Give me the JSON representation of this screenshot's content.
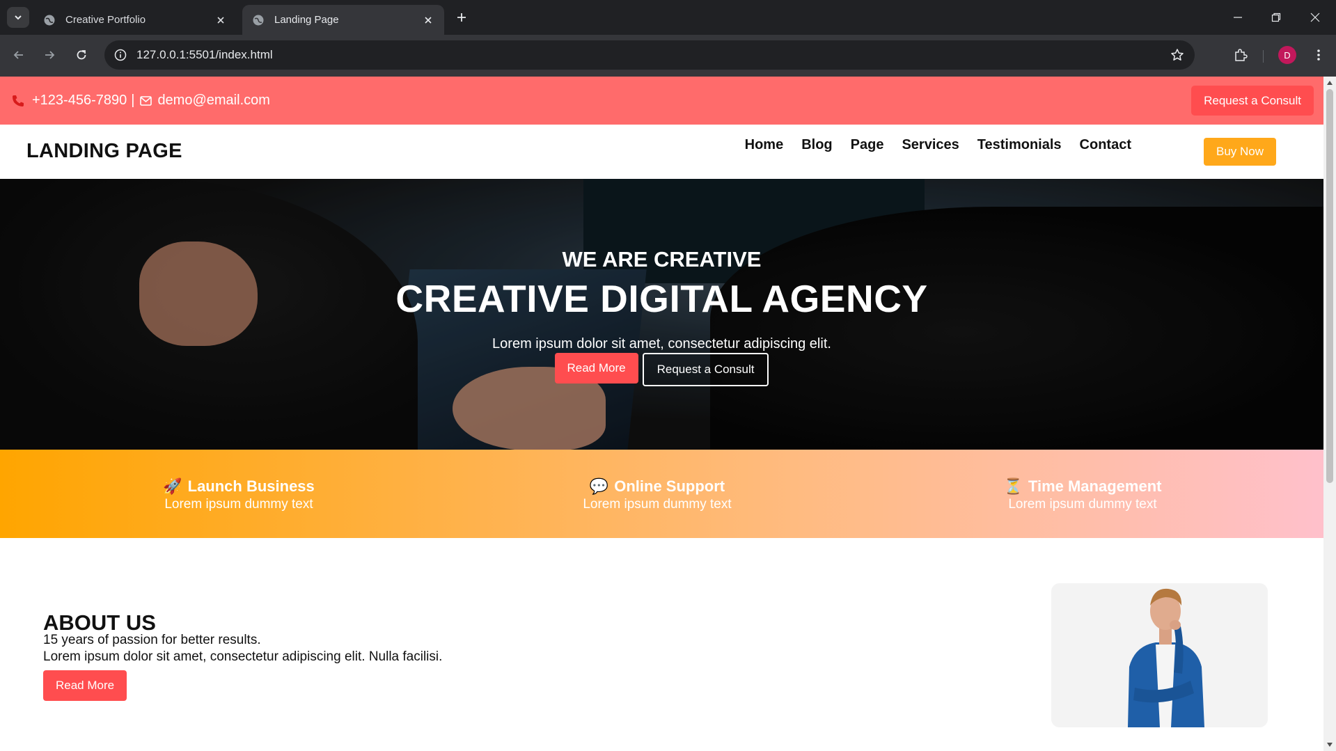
{
  "browser": {
    "tabs": [
      {
        "title": "Creative Portfolio"
      },
      {
        "title": "Landing Page"
      }
    ],
    "url": "127.0.0.1:5501/index.html",
    "profile_initial": "D"
  },
  "topbar": {
    "phone": "+123-456-7890",
    "separator": "|",
    "email": "demo@email.com",
    "consult_label": "Request a Consult",
    "bg_color": "#ff6b6b"
  },
  "navbar": {
    "logo": "LANDING PAGE",
    "menu": [
      "Home",
      "Blog",
      "Page",
      "Services",
      "Testimonials",
      "Contact"
    ],
    "buy_label": "Buy Now",
    "buy_color": "#ffa81a"
  },
  "hero": {
    "subtitle": "WE ARE CREATIVE",
    "title": "CREATIVE DIGITAL AGENCY",
    "description": "Lorem ipsum dolor sit amet, consectetur adipiscing elit.",
    "read_more_label": "Read More",
    "consult_label": "Request a Consult"
  },
  "features": [
    {
      "icon": "rocket-icon",
      "glyph": "🚀",
      "title": "Launch Business",
      "desc": "Lorem ipsum dummy text"
    },
    {
      "icon": "speech-bubble-icon",
      "glyph": "💬",
      "title": "Online Support",
      "desc": "Lorem ipsum dummy text"
    },
    {
      "icon": "hourglass-icon",
      "glyph": "⏳",
      "title": "Time Management",
      "desc": "Lorem ipsum dummy text"
    }
  ],
  "about": {
    "heading": "ABOUT US",
    "tagline": "15 years of passion for better results.",
    "body": "Lorem ipsum dolor sit amet, consectetur adipiscing elit. Nulla facilisi.",
    "read_more_label": "Read More"
  },
  "colors": {
    "accent_red": "#ff4d4f",
    "accent_orange": "#ffa500",
    "accent_pink": "#ffc0cb"
  }
}
